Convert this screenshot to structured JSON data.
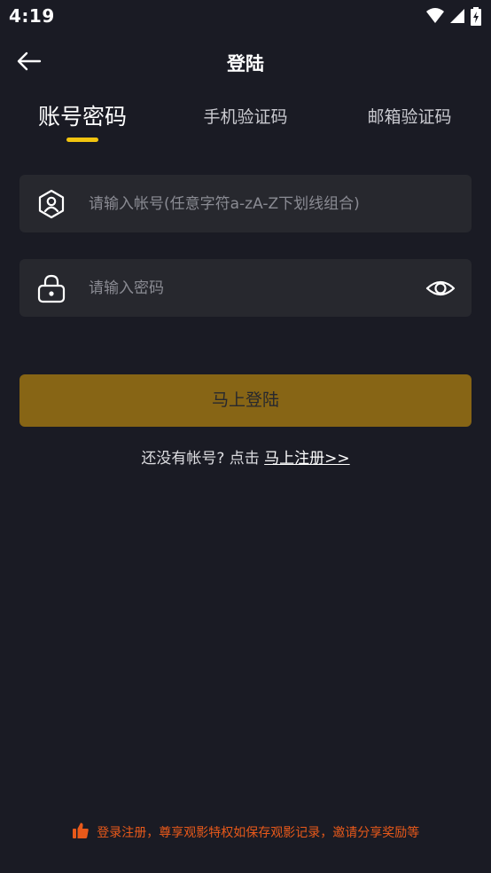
{
  "status_bar": {
    "time": "4:19",
    "icons": [
      "wifi-icon",
      "signal-icon",
      "battery-charging-icon"
    ]
  },
  "header": {
    "title": "登陆",
    "back_icon": "arrow-left-icon"
  },
  "tabs": [
    {
      "label": "账号密码",
      "active": true
    },
    {
      "label": "手机验证码",
      "active": false
    },
    {
      "label": "邮箱验证码",
      "active": false
    }
  ],
  "form": {
    "account": {
      "placeholder": "请输入帐号(任意字符a-zA-Z下划线组合)",
      "value": "",
      "icon": "user-hexagon-icon"
    },
    "password": {
      "placeholder": "请输入密码",
      "value": "",
      "icon": "lock-icon",
      "toggle_icon": "eye-icon"
    },
    "submit_label": "马上登陆"
  },
  "register": {
    "prompt": "还没有帐号? 点击",
    "link_label": "马上注册>>"
  },
  "footer": {
    "note": "登录注册，尊享观影特权如保存观影记录，邀请分享奖励等",
    "icon": "thumbs-up-icon"
  },
  "colors": {
    "background": "#1a1b24",
    "field": "#27282e",
    "accent": "#f1c40f",
    "button": "#876515",
    "footer_text": "#e8591a"
  }
}
